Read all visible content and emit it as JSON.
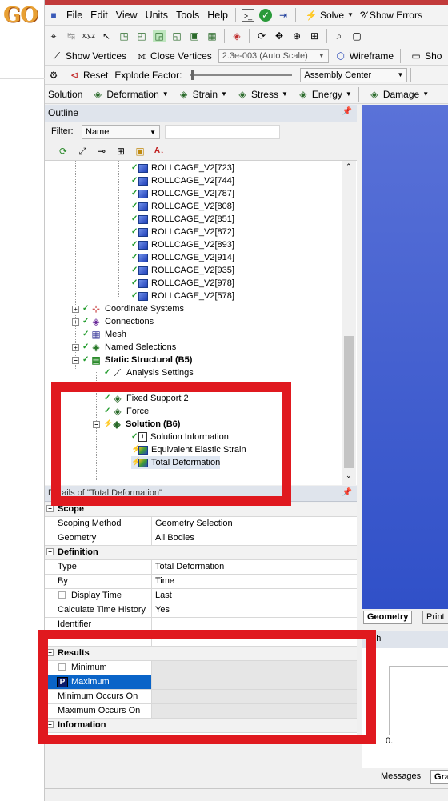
{
  "menu": [
    "File",
    "Edit",
    "View",
    "Units",
    "Tools",
    "Help"
  ],
  "toolbar1": {
    "solve": "Solve",
    "show_errors": "?⁄ Show Errors"
  },
  "toolbar2": {
    "show_vertices": "Show Vertices",
    "close_vertices": "Close Vertices",
    "scale": "2.3e-003 (Auto Scale)",
    "wireframe": "Wireframe",
    "show_cut": "Sho"
  },
  "toolbar3": {
    "reset": "Reset",
    "explode_factor": "Explode Factor:",
    "assembly": "Assembly Center"
  },
  "toolbar4": {
    "solution": "Solution",
    "deformation": "Deformation",
    "strain": "Strain",
    "stress": "Stress",
    "energy": "Energy",
    "damage": "Damage"
  },
  "outline": {
    "title": "Outline",
    "filter_label": "Filter:",
    "filter_value": "Name",
    "bodies": [
      "ROLLCAGE_V2[723]",
      "ROLLCAGE_V2[744]",
      "ROLLCAGE_V2[787]",
      "ROLLCAGE_V2[808]",
      "ROLLCAGE_V2[851]",
      "ROLLCAGE_V2[872]",
      "ROLLCAGE_V2[893]",
      "ROLLCAGE_V2[914]",
      "ROLLCAGE_V2[935]",
      "ROLLCAGE_V2[978]",
      "ROLLCAGE_V2[578]"
    ],
    "nodes": {
      "coord": "Coordinate Systems",
      "connections": "Connections",
      "mesh": "Mesh",
      "named": "Named Selections",
      "static": "Static Structural (B5)",
      "analysis": "Analysis Settings",
      "fixed": "Fixed Support 2",
      "force": "Force",
      "solution": "Solution (B6)",
      "sol_info": "Solution Information",
      "strain": "Equivalent Elastic Strain",
      "total": "Total Deformation"
    }
  },
  "details": {
    "title": "Details of \"Total Deformation\"",
    "rows": [
      {
        "label": "Scope",
        "value": "",
        "section": true
      },
      {
        "label": "Scoping Method",
        "value": "Geometry Selection"
      },
      {
        "label": "Geometry",
        "value": "All Bodies"
      },
      {
        "label": "Definition",
        "value": "",
        "section": true
      },
      {
        "label": "Type",
        "value": "Total Deformation"
      },
      {
        "label": "By",
        "value": "Time"
      },
      {
        "label": "Display Time",
        "value": "Last"
      },
      {
        "label": "Calculate Time History",
        "value": "Yes"
      },
      {
        "label": "Identifier",
        "value": ""
      },
      {
        "label": "",
        "value": ""
      },
      {
        "label": "Results",
        "value": "",
        "section": true
      },
      {
        "label": "Minimum",
        "value": ""
      },
      {
        "label": "Maximum",
        "value": ""
      },
      {
        "label": "Minimum Occurs On",
        "value": ""
      },
      {
        "label": "Maximum Occurs On",
        "value": ""
      },
      {
        "label": "Information",
        "value": "",
        "section": true
      }
    ]
  },
  "viewport_tabs": {
    "geometry": "Geometry",
    "print": "Print"
  },
  "graph": {
    "title": "aph",
    "zero": "0."
  },
  "bottom_tabs": {
    "messages": "Messages",
    "graph": "Gra"
  },
  "colors": {
    "highlight_red": "#e0191f",
    "viewport_blue": "#4a64d2",
    "selection_blue": "#0a64c8"
  }
}
